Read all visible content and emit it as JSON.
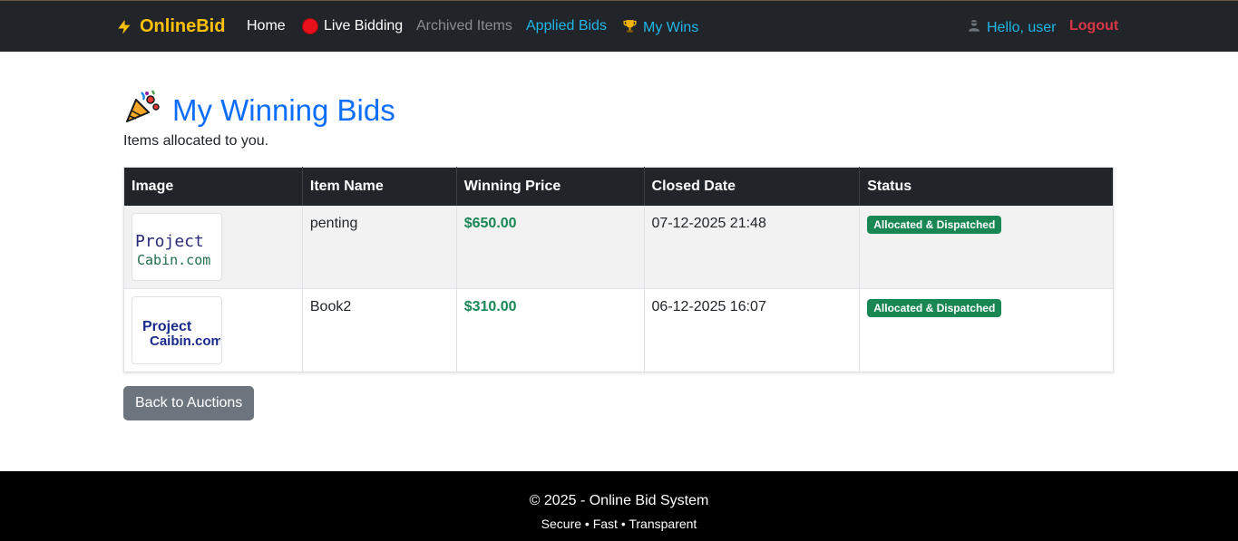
{
  "navbar": {
    "brand": "OnlineBid",
    "links": {
      "home": "Home",
      "live": "Live Bidding",
      "archived": "Archived Items",
      "applied": "Applied Bids",
      "wins": "My Wins"
    },
    "user_greeting": "Hello, user",
    "logout": "Logout"
  },
  "page": {
    "title": "My Winning Bids",
    "subtitle": "Items allocated to you."
  },
  "table": {
    "headers": [
      "Image",
      "Item Name",
      "Winning Price",
      "Closed Date",
      "Status"
    ],
    "rows": [
      {
        "image_text": [
          "Project",
          "Cabin.com"
        ],
        "item_name": "penting",
        "price": "$650.00",
        "closed_date": "07-12-2025 21:48",
        "status": "Allocated & Dispatched"
      },
      {
        "image_text": [
          "Project",
          "Caibin.com"
        ],
        "item_name": "Book2",
        "price": "$310.00",
        "closed_date": "06-12-2025 16:07",
        "status": "Allocated & Dispatched"
      }
    ]
  },
  "buttons": {
    "back": "Back to Auctions"
  },
  "footer": {
    "copyright": "© 2025 - Online Bid System",
    "tagline": "Secure • Fast • Transparent"
  },
  "colors": {
    "navbar_bg": "#212529",
    "brand": "#ffc107",
    "link_accent": "#1fb6e8",
    "logout": "#dc3545",
    "title": "#0d6efd",
    "success": "#198754",
    "button_secondary": "#6c757d",
    "footer_bg": "#000000"
  },
  "icons": {
    "brand": "lightning-bolt-icon",
    "live": "red-circle-icon",
    "wins": "trophy-icon",
    "user": "user-icon",
    "title": "party-popper-icon"
  }
}
